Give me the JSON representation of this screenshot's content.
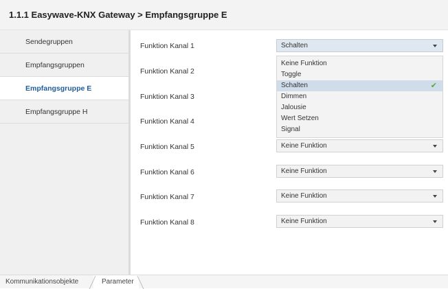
{
  "header": {
    "title": "1.1.1 Easywave-KNX Gateway > Empfangsgruppe E"
  },
  "sidebar": {
    "items": [
      {
        "label": "Sendegruppen"
      },
      {
        "label": "Empfangsgruppen"
      },
      {
        "label": "Empfangsgruppe E",
        "active": true
      },
      {
        "label": "Empfangsgruppe H"
      }
    ]
  },
  "rows": [
    {
      "label": "Funktion Kanal 1",
      "value": "Schalten",
      "open": true
    },
    {
      "label": "Funktion Kanal 2"
    },
    {
      "label": "Funktion Kanal 3"
    },
    {
      "label": "Funktion Kanal 4"
    },
    {
      "label": "Funktion Kanal 5",
      "value": "Keine Funktion"
    },
    {
      "label": "Funktion Kanal 6",
      "value": "Keine Funktion"
    },
    {
      "label": "Funktion Kanal 7",
      "value": "Keine Funktion"
    },
    {
      "label": "Funktion Kanal 8",
      "value": "Keine Funktion"
    }
  ],
  "dropdown": {
    "options": [
      "Keine Funktion",
      "Toggle",
      "Schalten",
      "Dimmen",
      "Jalousie",
      "Wert Setzen",
      "Signal"
    ],
    "selected": "Schalten",
    "check_icon": "checkmark-icon",
    "check_color": "#5aa838"
  },
  "tabs": [
    {
      "label": "Kommunikationsobjekte"
    },
    {
      "label": "Parameter",
      "active": true
    }
  ],
  "colors": {
    "active_text": "#1f5c99",
    "selected_option_bg": "#cfdce9"
  }
}
